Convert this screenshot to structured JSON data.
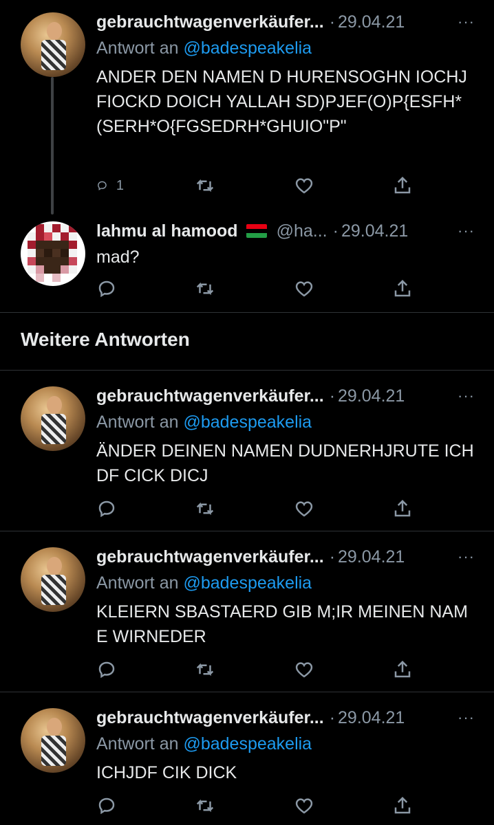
{
  "tweets": [
    {
      "name": "gebrauchtwagenverkäufer...",
      "dot": "·",
      "date": "29.04.21",
      "more": "···",
      "reply_prefix": "Antwort an",
      "reply_handle": "@badespeakelia",
      "text": "ANDER DEN NAMEN D HURENSOGHN IOCHJ FIOCKD DOICH YALLAH SD)PJEF(O)P{ESFH*(SERH*O{FGSEDRH*GHUIO\"P\"",
      "reply_count": "1"
    },
    {
      "name": "lahmu al hamood",
      "handle": "@ha...",
      "dot": "·",
      "date": "29.04.21",
      "more": "···",
      "text": "mad?"
    },
    {
      "name": "gebrauchtwagenverkäufer...",
      "dot": "·",
      "date": "29.04.21",
      "more": "···",
      "reply_prefix": "Antwort an",
      "reply_handle": "@badespeakelia",
      "text": "ÄNDER DEINEN NAMEN DUDNERHJRUTE ICHDF CICK DICJ"
    },
    {
      "name": "gebrauchtwagenverkäufer...",
      "dot": "·",
      "date": "29.04.21",
      "more": "···",
      "reply_prefix": "Antwort an",
      "reply_handle": "@badespeakelia",
      "text": "KLEIERN SBASTAERD GIB M;IR MEINEN NAME WIRNEDER"
    },
    {
      "name": "gebrauchtwagenverkäufer...",
      "dot": "·",
      "date": "29.04.21",
      "more": "···",
      "reply_prefix": "Antwort an",
      "reply_handle": "@badespeakelia",
      "text": "ICHJDF CIK DICK"
    }
  ],
  "section_title": "Weitere Antworten",
  "icons": {
    "reply": "reply-icon",
    "retweet": "retweet-icon",
    "like": "heart-icon",
    "share": "share-icon"
  },
  "colors": {
    "background": "#000000",
    "text": "#e7e9ea",
    "muted": "#8b98a5",
    "link": "#1d9bf0",
    "divider": "#2f3336"
  }
}
